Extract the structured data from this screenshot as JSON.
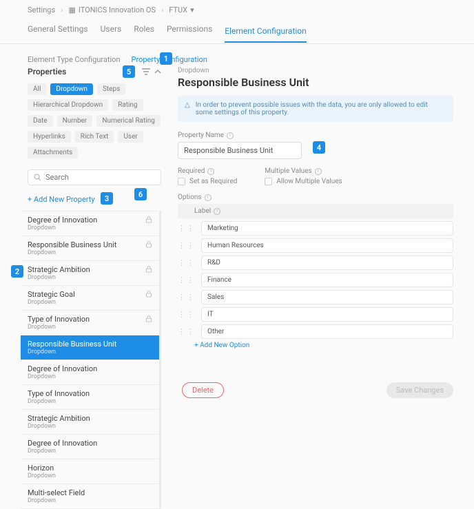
{
  "breadcrumbs": {
    "a": "Settings",
    "b": "ITONICS Innovation OS",
    "c": "FTUX"
  },
  "topnav": {
    "general": "General Settings",
    "users": "Users",
    "roles": "Roles",
    "permissions": "Permissions",
    "element_config": "Element Configuration"
  },
  "subnav": {
    "type_cfg": "Element Type Configuration",
    "prop_cfg": "Property Configuration"
  },
  "props_header": "Properties",
  "filters": {
    "all": "All",
    "dropdown": "Dropdown",
    "steps": "Steps",
    "hier": "Hierarchical Dropdown",
    "rating": "Rating",
    "date": "Date",
    "number": "Number",
    "num_rating": "Numerical Rating",
    "links": "Hyperlinks",
    "rich": "Rich Text",
    "user": "User",
    "attach": "Attachments"
  },
  "search_placeholder": "Search",
  "add_new_property": "+ Add New Property",
  "properties": [
    {
      "name": "Degree of Innovation",
      "type": "Dropdown",
      "locked": true
    },
    {
      "name": "Responsible Business Unit",
      "type": "Dropdown",
      "locked": true
    },
    {
      "name": "Strategic Ambition",
      "type": "Dropdown",
      "locked": true
    },
    {
      "name": "Strategic Goal",
      "type": "Dropdown",
      "locked": true
    },
    {
      "name": "Type of Innovation",
      "type": "Dropdown",
      "locked": true
    },
    {
      "name": "Responsible Business Unit",
      "type": "Dropdown",
      "active": true
    },
    {
      "name": "Degree of Innovation",
      "type": "Dropdown"
    },
    {
      "name": "Type of Innovation",
      "type": "Dropdown"
    },
    {
      "name": "Strategic Ambition",
      "type": "Dropdown"
    },
    {
      "name": "Degree of Innovation",
      "type": "Dropdown"
    },
    {
      "name": "Horizon",
      "type": "Dropdown"
    },
    {
      "name": "Multi-select Field",
      "type": "Dropdown"
    }
  ],
  "detail": {
    "eyebrow": "Dropdown",
    "title": "Responsible Business Unit",
    "notice": "In order to prevent possible issues with the data, you are only allowed to edit some settings of this property.",
    "labels": {
      "prop_name": "Property Name",
      "required": "Required",
      "multiple": "Multiple Values",
      "set_required": "Set as Required",
      "allow_multi": "Allow Multiple Values",
      "options": "Options",
      "label": "Label"
    },
    "prop_name_value": "Responsible Business Unit",
    "options": [
      "Marketing",
      "Human Resources",
      "R&D",
      "Finance",
      "Sales",
      "IT",
      "Other"
    ],
    "add_option": "+ Add New Option"
  },
  "footer": {
    "delete": "Delete",
    "save": "Save Changes"
  },
  "callouts": {
    "c1": "1",
    "c2": "2",
    "c3": "3",
    "c4": "4",
    "c5": "5",
    "c6": "6"
  }
}
